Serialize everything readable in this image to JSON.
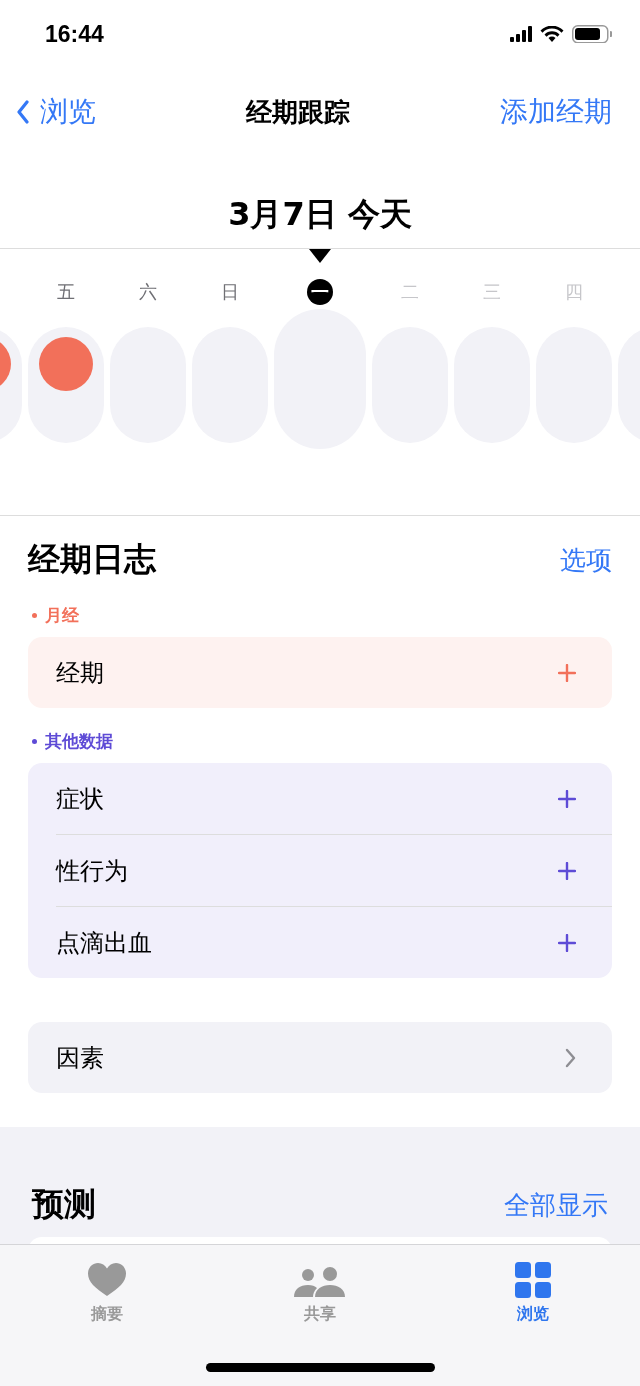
{
  "status_bar": {
    "time": "16:44"
  },
  "nav": {
    "back": "浏览",
    "title": "经期跟踪",
    "action": "添加经期"
  },
  "date_header": "3月7日 今天",
  "days": [
    {
      "period": true
    },
    {
      "label": "五",
      "period": true,
      "selected": false,
      "future": false
    },
    {
      "label": "六",
      "period": false,
      "selected": false,
      "future": false
    },
    {
      "label": "日",
      "period": false,
      "selected": false,
      "future": false
    },
    {
      "label": "一",
      "period": false,
      "selected": true,
      "future": false
    },
    {
      "label": "二",
      "period": false,
      "selected": false,
      "future": true
    },
    {
      "label": "三",
      "period": false,
      "selected": false,
      "future": true
    },
    {
      "label": "四",
      "period": false,
      "selected": false,
      "future": true
    },
    {
      "period": false
    }
  ],
  "log": {
    "title": "经期日志",
    "action": "选项",
    "groups": [
      {
        "label": "月经",
        "color": "#f2705a",
        "items": [
          "经期"
        ]
      },
      {
        "label": "其他数据",
        "color": "#5e4bd6",
        "items": [
          "症状",
          "性行为",
          "点滴出血"
        ]
      }
    ],
    "factors": "因素"
  },
  "predictions": {
    "title": "预测",
    "action": "全部显示"
  },
  "tabs": [
    {
      "label": "摘要",
      "kind": "heart",
      "selected": false
    },
    {
      "label": "共享",
      "kind": "people",
      "selected": false
    },
    {
      "label": "浏览",
      "kind": "grid",
      "selected": true
    }
  ]
}
